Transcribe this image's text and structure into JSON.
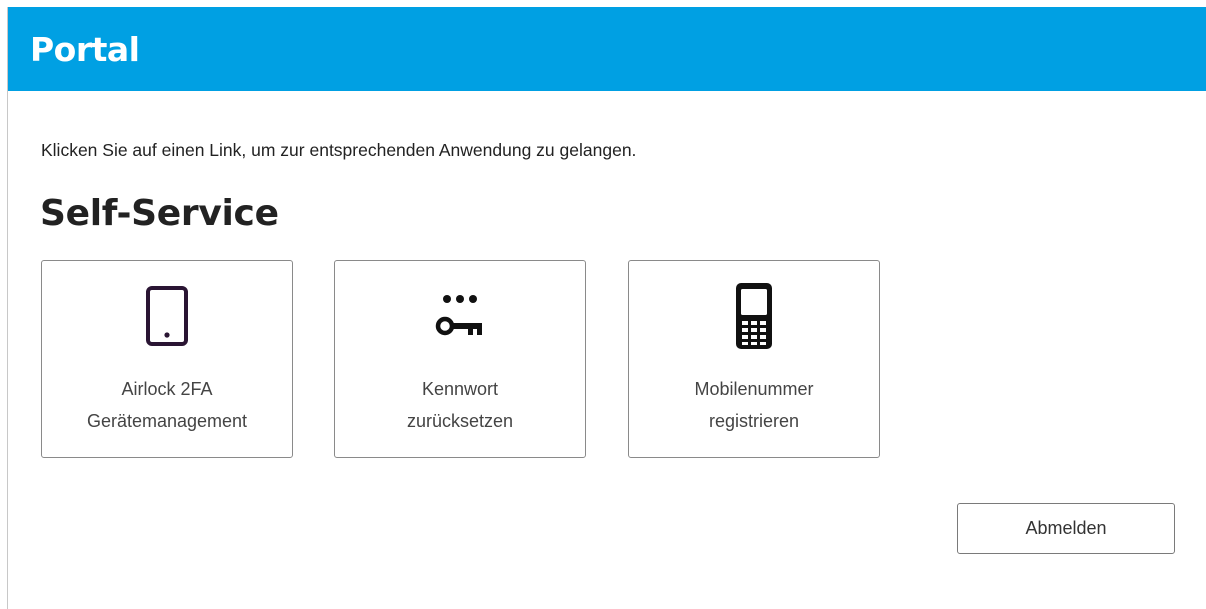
{
  "header": {
    "title": "Portal",
    "color": "#00a0e3"
  },
  "intro": {
    "text": "Klicken Sie auf einen Link, um zur entsprechenden Anwendung zu gelangen."
  },
  "section": {
    "title": "Self-Service"
  },
  "tiles": [
    {
      "icon": "tablet-icon",
      "line1": "Airlock 2FA",
      "line2": "Gerätemanagement"
    },
    {
      "icon": "password-key-icon",
      "line1": "Kennwort",
      "line2": "zurücksetzen"
    },
    {
      "icon": "mobile-phone-icon",
      "line1": "Mobilenummer",
      "line2": "registrieren"
    }
  ],
  "actions": {
    "logout_label": "Abmelden"
  }
}
